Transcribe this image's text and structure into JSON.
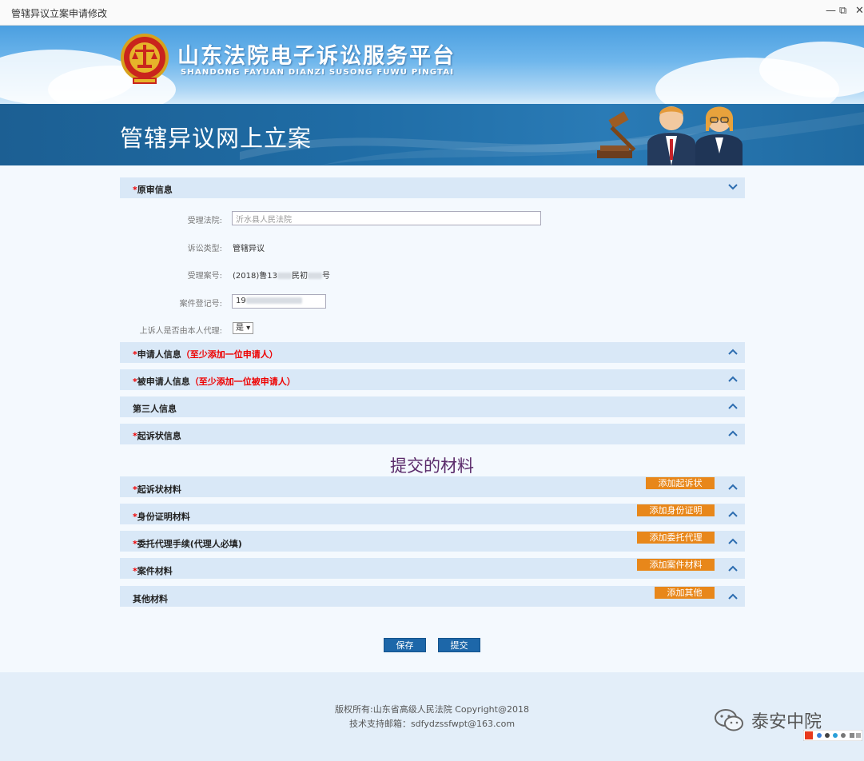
{
  "window": {
    "title": "管辖异议立案申请修改"
  },
  "banner": {
    "title": "山东法院电子诉讼服务平台",
    "subtitle": "SHANDONG FAYUAN DIANZI SUSONG FUWU PINGTAI",
    "page_title": "管辖异议网上立案"
  },
  "sections": {
    "original_trial": {
      "req": "*",
      "label": "原审信息"
    },
    "applicant": {
      "req": "*",
      "label": "申请人信息",
      "note": "（至少添加一位申请人）"
    },
    "respondent": {
      "req": "*",
      "label": "被申请人信息",
      "note": "（至少添加一位被申请人）"
    },
    "third_party": {
      "label": "第三人信息"
    },
    "complaint": {
      "req": "*",
      "label": "起诉状信息"
    }
  },
  "form": {
    "court_label": "受理法院:",
    "court_value": "沂水县人民法院",
    "type_label": "诉讼类型:",
    "type_value": "管辖异议",
    "case_no_label": "受理案号:",
    "case_no_prefix": "(2018)鲁13",
    "case_no_mid": "民初",
    "case_no_suffix": "号",
    "reg_label": "案件登记号:",
    "reg_value": "19",
    "self_agent_label": "上诉人是否由本人代理:",
    "self_agent_value": "是 ▾"
  },
  "materials": {
    "heading": "提交的材料",
    "items": [
      {
        "req": "*",
        "label": "起诉状材料",
        "button": "添加起诉状"
      },
      {
        "req": "*",
        "label": "身份证明材料",
        "button": "添加身份证明"
      },
      {
        "req": "*",
        "label": "委托代理手续(代理人必填)",
        "button": "添加委托代理"
      },
      {
        "req": "*",
        "label": "案件材料",
        "button": "添加案件材料"
      },
      {
        "req": "",
        "label": "其他材料",
        "button": "添加其他"
      }
    ]
  },
  "actions": {
    "save": "保存",
    "submit": "提交"
  },
  "footer": {
    "copyright": "版权所有:山东省高级人民法院 Copyright@2018",
    "support": "技术支持邮箱：sdfydzssfwpt@163.com"
  },
  "watermark": {
    "text": "泰安中院"
  },
  "colors": {
    "accent": "#1d67a9",
    "add_button": "#e8871a",
    "section_bar": "#d9e8f7",
    "required": "#ee0000"
  }
}
